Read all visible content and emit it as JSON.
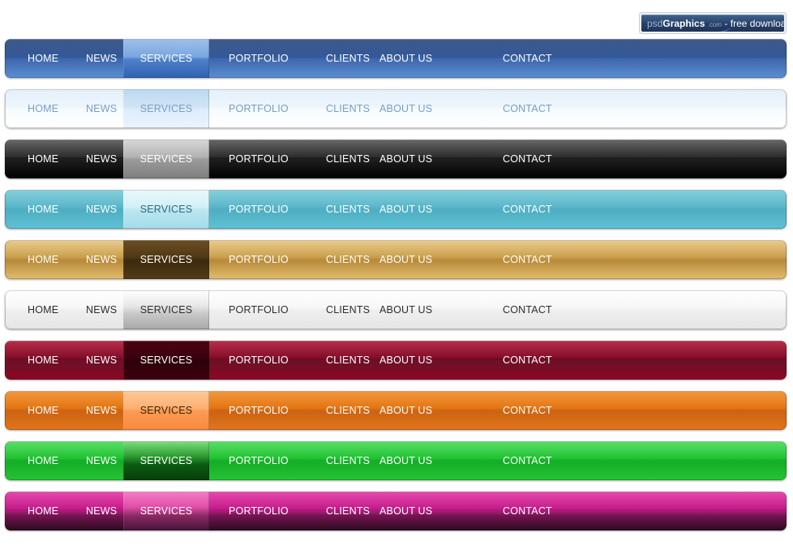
{
  "badge": {
    "name": "psdgraphics-badge",
    "text_psd": "psd",
    "text_graphics": "Graphics",
    "text_com": ".com",
    "text_free": "- free download"
  },
  "menu_labels": [
    "HOME",
    "NEWS",
    "SERVICES",
    "PORTFOLIO",
    "CLIENTS",
    "ABOUT US",
    "CONTACT"
  ],
  "active_index": 2,
  "bars": [
    {
      "id": "navbar-blue",
      "name": "blue",
      "background": "linear-gradient(to bottom, #1b3a73 0%, #2d5496 46%, #325da6 50%, #5b8fd4 100%)",
      "text_color": "#ffffff",
      "active_background": "linear-gradient(to bottom, #9dc0ea 0%, #79a6e0 46%, #4f81cb 52%, #2f62b4 100%)",
      "active_text_color": "#ffffff"
    },
    {
      "id": "navbar-lightblue",
      "name": "light-blue",
      "background": "linear-gradient(to bottom, #dfedfa 0%, #eef6fd 46%, #f7fbfe 52%, #ffffff 100%)",
      "text_color": "#7a9ec4",
      "active_background": "linear-gradient(to bottom, #bcd9f0 0%, #cfe5f6 46%, #dcedfa 52%, #eaf4fd 100%)",
      "active_text_color": "#7a9ec4"
    },
    {
      "id": "navbar-black",
      "name": "black",
      "background": "linear-gradient(to bottom, #4a4a4a 0%, #262626 44%, #111111 50%, #000000 100%)",
      "text_color": "#ffffff",
      "active_background": "linear-gradient(to bottom, #d8d8d8 0%, #b3b3b3 44%, #9a9a9a 52%, #7e7e7e 100%)",
      "active_text_color": "#ffffff"
    },
    {
      "id": "navbar-cyan",
      "name": "cyan",
      "background": "linear-gradient(to bottom, #6fc6d6 0%, #53b4c8 44%, #45a9bf 52%, #5fc2d4 100%)",
      "text_color": "#ffffff",
      "active_background": "linear-gradient(to bottom, #e9f8fb 0%, #d3f0f6 44%, #bbe6ef 52%, #a4dce9 100%)",
      "active_text_color": "#2c6b7d"
    },
    {
      "id": "navbar-gold",
      "name": "gold",
      "background": "linear-gradient(to bottom, #e6c277 0%, #c89b45 44%, #b3832f 52%, #e2bd6e 100%)",
      "text_color": "#ffffff",
      "active_background": "linear-gradient(to bottom, #6b4f22 0%, #4f3914 44%, #3c2a0d 52%, #523c16 100%)",
      "active_text_color": "#ffffff"
    },
    {
      "id": "navbar-white",
      "name": "white",
      "background": "linear-gradient(to bottom, #ffffff 0%, #f7f7f7 44%, #ededed 52%, #e6e6e6 100%)",
      "text_color": "#2e2e2e",
      "active_background": "linear-gradient(to bottom, #ffffff 0%, #e7e7e7 40%, #c8c8c8 60%, #a8a8a8 100%)",
      "active_text_color": "#2e2e2e"
    },
    {
      "id": "navbar-darkred",
      "name": "dark-red",
      "background": "linear-gradient(to bottom, #a8082a 0%, #7e0420 44%, #62031a 52%, #8e0624 100%)",
      "text_color": "#ffffff",
      "active_background": "linear-gradient(to bottom, #4d0213 0%, #3a010e 44%, #2c010a 52%, #3d0110 100%)",
      "active_text_color": "#ffffff"
    },
    {
      "id": "navbar-orange",
      "name": "orange",
      "background": "linear-gradient(to bottom, #f08416 0%, #e2700b 44%, #c95a05 52%, #e2761c 100%)",
      "text_color": "#ffffff",
      "active_background": "linear-gradient(to bottom, #ffc998 0%, #fdb071 44%, #fb9b53 52%, #f98a3d 100%)",
      "active_text_color": "#3a2206"
    },
    {
      "id": "navbar-green",
      "name": "green",
      "background": "linear-gradient(to bottom, #3ad84b 0%, #17bf2a 44%, #07a81a 52%, #25c436 100%)",
      "text_color": "#ffffff",
      "active_background": "linear-gradient(to bottom, #7ae07d 0%, #2f9c33 38%, #0a5c11 60%, #063d0b 100%)",
      "active_text_color": "#ffffff"
    },
    {
      "id": "navbar-magenta",
      "name": "magenta",
      "background": "linear-gradient(to bottom, #e0289d 0%, #c21386 44%, #6e0a4a 62%, #2a0b1d 100%)",
      "text_color": "#ffffff",
      "active_background": "linear-gradient(to bottom, #f47ec5 0%, #e04da6 40%, #8c2964 62%, #43153a 100%)",
      "active_text_color": "#ffffff"
    }
  ]
}
